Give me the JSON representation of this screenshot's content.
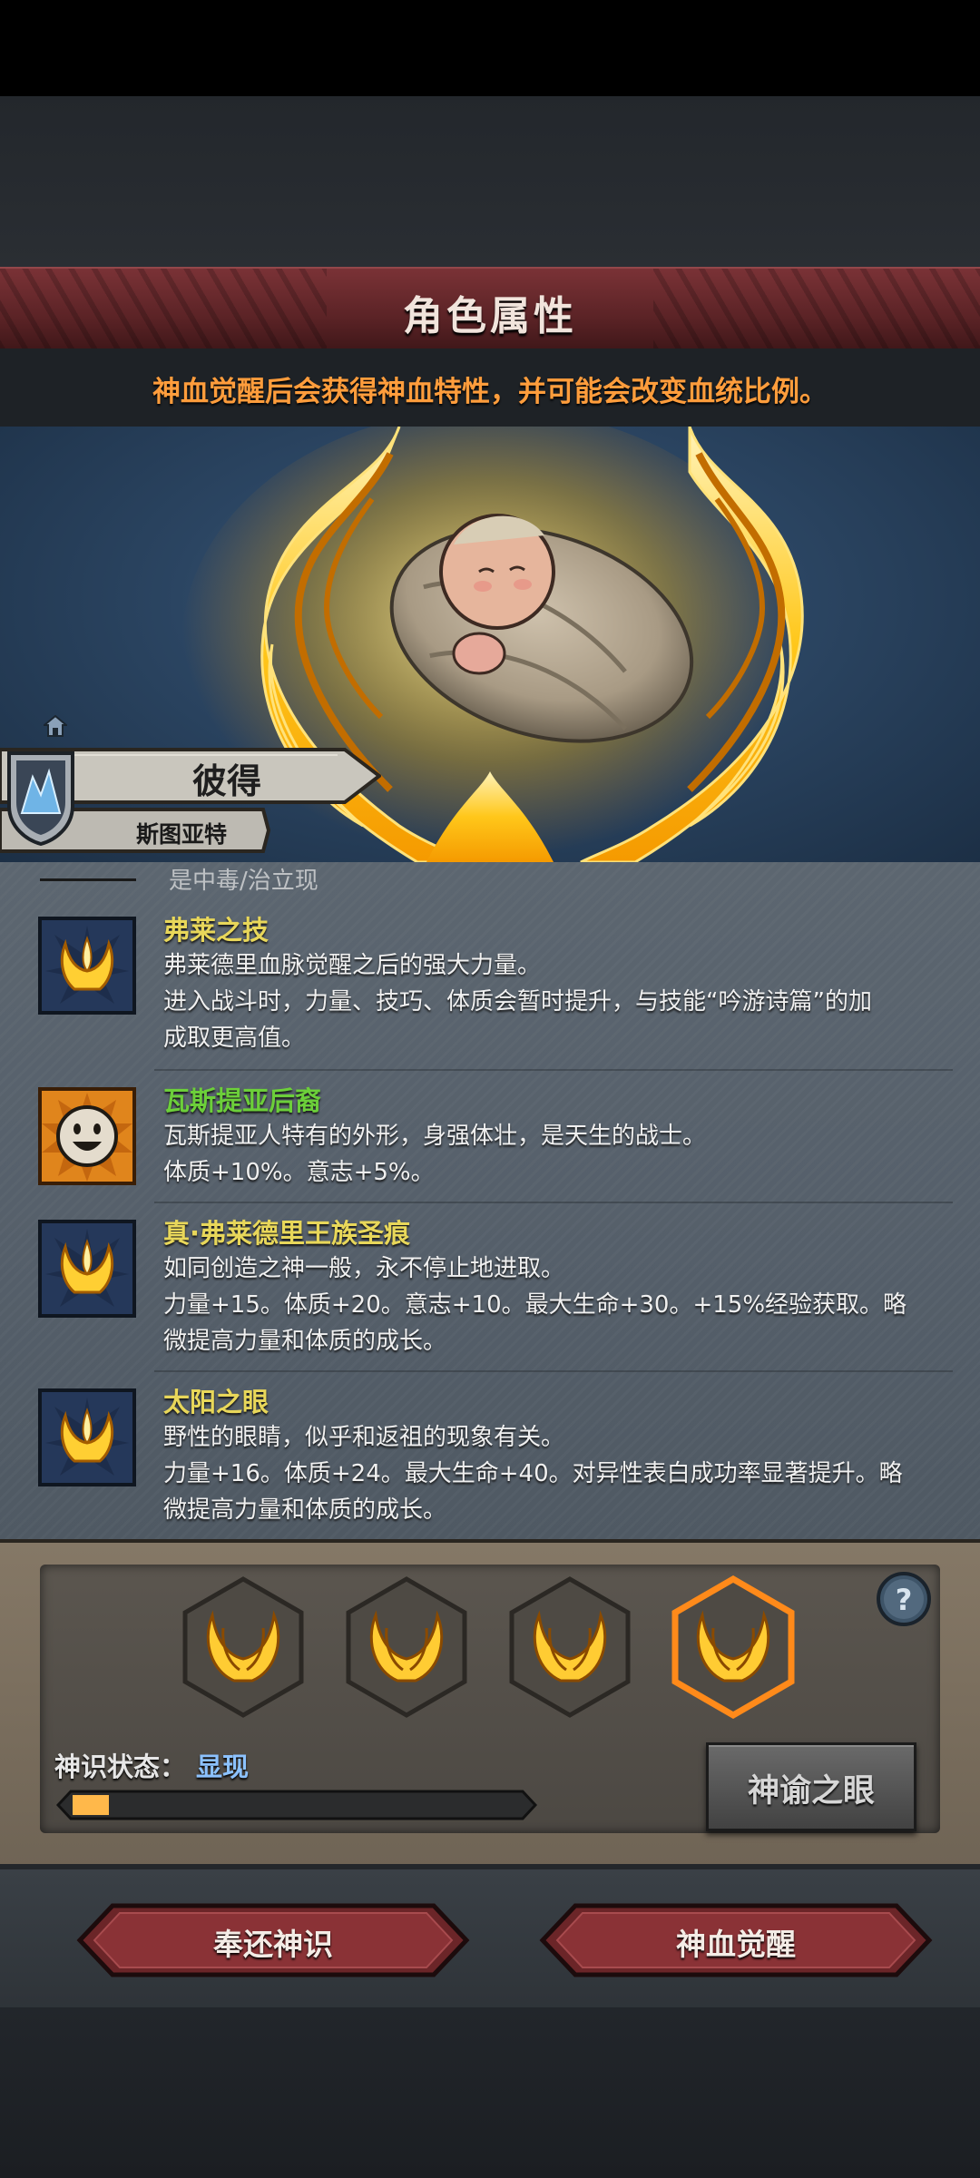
{
  "header": {
    "title": "角色属性",
    "subtitle": "神血觉醒后会获得神血特性，并可能会改变血统比例。"
  },
  "character": {
    "name": "彼得",
    "origin": "斯图亚特"
  },
  "traits": {
    "cut_off_text": "是中毒/治立现",
    "items": [
      {
        "name": "弗莱之技",
        "name_color": "#e8d75a",
        "icon": "golden-crown-flame-icon",
        "lines": [
          "弗莱德里血脉觉醒之后的强大力量。",
          "进入战斗时，力量、技巧、体质会暂时提升，与技能“吟游诗篇”的加",
          "成取更高值。"
        ]
      },
      {
        "name": "瓦斯提亚后裔",
        "name_color": "#6ccf3a",
        "icon": "smiling-face-icon",
        "lines": [
          "瓦斯提亚人特有的外形，身强体壮，是天生的战士。",
          "体质+10%。意志+5%。"
        ]
      },
      {
        "name": "真·弗莱德里王族圣痕",
        "name_color": "#e8d75a",
        "icon": "golden-crown-flame-icon",
        "lines": [
          "如同创造之神一般，永不停止地进取。",
          "力量+15。体质+20。意志+10。最大生命+30。+15%经验获取。略",
          "微提高力量和体质的成长。"
        ]
      },
      {
        "name": "太阳之眼",
        "name_color": "#e8d75a",
        "icon": "golden-crown-flame-icon",
        "lines": [
          "野性的眼睛，似乎和返祖的现象有关。",
          "力量+16。体质+24。最大生命+40。对异性表白成功率显著提升。略",
          "微提高力量和体质的成长。"
        ]
      }
    ]
  },
  "divine": {
    "status_label": "神识状态：",
    "status_value": "显现",
    "progress": 0.08,
    "selected_slot": 4,
    "slots": [
      "golden-wings-icon",
      "golden-wings-icon",
      "golden-wings-icon",
      "golden-wings-icon"
    ],
    "oracle_button": "神谕之眼"
  },
  "actions": {
    "return_button": "奉还神识",
    "awaken_button": "神血觉醒"
  },
  "colors": {
    "accent_orange": "#ff9d3c",
    "title_red": "#5b2326",
    "status_blue": "#8cc2ff",
    "progress_fill": "#ffb84a"
  }
}
